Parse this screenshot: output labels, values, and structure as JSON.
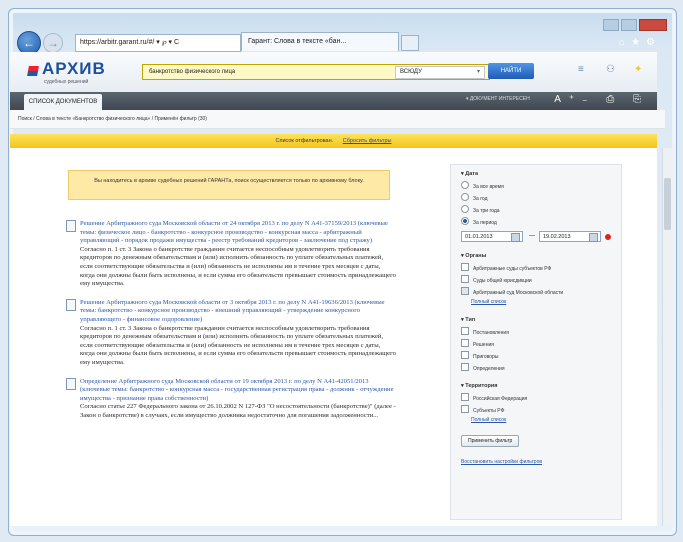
{
  "browser": {
    "address": "https://arbitr.garant.ru/#/ ▾ ℘ ▾ C",
    "tab_title": "Гарант: Слова в тексте «бан..."
  },
  "app": {
    "logo": "АРХИВ",
    "logo_sub": "судебных решений",
    "search_value": "банкротство физического лица",
    "scope": "ВСЮДУ",
    "find_button": "НАЙТИ"
  },
  "toolbar": {
    "section_tab": "СПИСОК ДОКУМЕНТОВ",
    "link": "▾ ДОКУМЕНТ ИНТЕРЕСЕН",
    "icons": "A⁺₋ ⎙ ⎘"
  },
  "breadcrumb": "Поиск / Слова в тексте «Банкротство физического лица» / Применён фильтр (30)",
  "filterbar": {
    "text": "Список отфильтрован.",
    "reset": "Сбросить фильтры"
  },
  "notice": "Вы находитесь в архиве судебных решений ГАРАНТа, поиск осуществляется только по архивному блоку.",
  "results": [
    {
      "title": "Решение Арбитражного суда Московской области от 24 октября 2013 г. по делу N А41-37159/2013 (ключевые темы: физическое лицо - банкротство - конкурсное производство - конкурсная масса - арбитражный управляющий - порядок продажи имущества - реестр требований кредиторов - заключение под стражу)",
      "snippet": "Согласно п. 1 ст. 3 Закона о банкротстве гражданин считается неспособным удовлетворить требования кредиторов по денежным обязательствам и (или) исполнить обязанность по уплате обязательных платежей, если соответствующие обязательства и (или) обязанность не исполнены им в течение трех месяцев с даты, когда они должны были быть исполнены, и если сумма его обязательств превышает стоимость принадлежащего ему имущества."
    },
    {
      "title": "Решение Арбитражного суда Московской области от 3 октября 2013 г. по делу N А41-19636/2013 (ключевые темы: банкротство - конкурсное производство - внешний управляющий - утверждение конкурсного управляющего - финансовое оздоровление)",
      "snippet": "Согласно п. 1 ст. 3 Закона о банкротстве гражданин считается неспособным удовлетворить требования кредиторов по денежным обязательствам и (или) исполнить обязанность по уплате обязательных платежей, если соответствующие обязательства и (или) обязанность не исполнены им в течение трех месяцев с даты, когда они должны были быть исполнены, и если сумма его обязательств превышает стоимость принадлежащего ему имущества."
    },
    {
      "title": "Определение Арбитражного суда Московской области от 19 октября 2013 г. по делу N А41-42051/2013 (ключевые темы: банкротство - конкурсная масса - государственная регистрация права - должник - отчуждение имущества - признание права собственности)",
      "snippet": "Согласно статье 227 Федерального закона от 26.10.2002 N 127-ФЗ \"О несостоятельности (банкротстве)\" (далее - Закон о банкротстве) в случаях, если имущество должника недостаточно для погашения задолженности..."
    }
  ],
  "sidebar": {
    "date": {
      "header": "▾ Дата",
      "options": [
        "За все время",
        "За год",
        "За три года",
        "За период"
      ],
      "from": "01.01.2013",
      "to": "19.02.2013"
    },
    "court": {
      "header": "▾ Органы",
      "options": [
        "Арбитражные суды субъектов РФ",
        "Суды общей юрисдикции",
        "Арбитражный суд Московской области"
      ],
      "more": "Полный список"
    },
    "type": {
      "header": "▾ Тип",
      "options": [
        "Постановления",
        "Решения",
        "Приговоры",
        "Определения"
      ]
    },
    "territory": {
      "header": "▾ Территория",
      "options": [
        "Российская Федерация",
        "Субъекты РФ"
      ],
      "more": "Полный список"
    },
    "apply_button": "Применить фильтр",
    "reset_link": "Восстановить настройки фильтров"
  }
}
